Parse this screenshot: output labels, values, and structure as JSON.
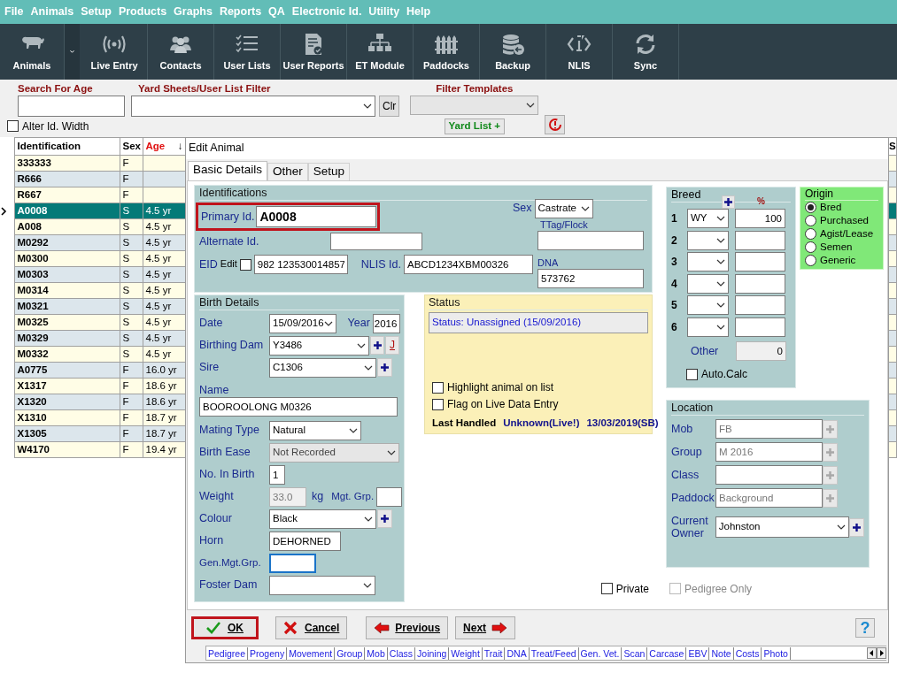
{
  "menu": [
    "File",
    "Animals",
    "Setup",
    "Products",
    "Graphs",
    "Reports",
    "QA",
    "Electronic Id.",
    "Utility",
    "Help"
  ],
  "toolbar": [
    {
      "label": "Animals",
      "dropdown": true
    },
    {
      "label": "Live Entry",
      "dropdown": false
    },
    {
      "label": "Contacts",
      "dropdown": false
    },
    {
      "label": "User Lists",
      "dropdown": false
    },
    {
      "label": "User Reports",
      "dropdown": false
    },
    {
      "label": "ET Module",
      "dropdown": false
    },
    {
      "label": "Paddocks",
      "dropdown": false
    },
    {
      "label": "Backup",
      "dropdown": false
    },
    {
      "label": "NLIS",
      "dropdown": false
    },
    {
      "label": "Sync",
      "dropdown": false
    }
  ],
  "filters": {
    "search": {
      "label": "Search For Age"
    },
    "user_list": {
      "label": "Yard Sheets/User List Filter"
    },
    "clear_button": "Clr",
    "templates": {
      "label": "Filter Templates",
      "disabled": true
    },
    "yard_list_button": "Yard List +",
    "alter_id_width": {
      "label": "Alter Id. Width",
      "checked": false
    }
  },
  "animal_list": {
    "columns": [
      "Identification",
      "Sex",
      "Age"
    ],
    "sort_indicator": "↓",
    "edge_column": "S",
    "rows": [
      {
        "id": "333333",
        "sex": "F",
        "selected": false
      },
      {
        "id": "R666",
        "sex": "F",
        "selected": false
      },
      {
        "id": "R667",
        "sex": "F",
        "selected": false
      },
      {
        "id": "A0008",
        "sex": "S",
        "age": "4.5 yr",
        "selected": true
      },
      {
        "id": "A008",
        "sex": "S",
        "age": "4.5 yr",
        "selected": false
      },
      {
        "id": "M0292",
        "sex": "S",
        "age": "4.5 yr",
        "selected": false
      },
      {
        "id": "M0300",
        "sex": "S",
        "age": "4.5 yr",
        "selected": false
      },
      {
        "id": "M0303",
        "sex": "S",
        "age": "4.5 yr",
        "selected": false
      },
      {
        "id": "M0314",
        "sex": "S",
        "age": "4.5 yr",
        "selected": false
      },
      {
        "id": "M0321",
        "sex": "S",
        "age": "4.5 yr",
        "selected": false
      },
      {
        "id": "M0325",
        "sex": "S",
        "age": "4.5 yr",
        "selected": false
      },
      {
        "id": "M0329",
        "sex": "S",
        "age": "4.5 yr",
        "selected": false
      },
      {
        "id": "M0332",
        "sex": "S",
        "age": "4.5 yr",
        "selected": false
      },
      {
        "id": "A0775",
        "sex": "F",
        "age": "16.0 yr",
        "selected": false
      },
      {
        "id": "X1317",
        "sex": "F",
        "age": "18.6 yr",
        "selected": false
      },
      {
        "id": "X1320",
        "sex": "F",
        "age": "18.6 yr",
        "selected": false
      },
      {
        "id": "X1310",
        "sex": "F",
        "age": "18.7 yr",
        "selected": false
      },
      {
        "id": "X1305",
        "sex": "F",
        "age": "18.7 yr",
        "selected": false
      },
      {
        "id": "W4170",
        "sex": "F",
        "age": "19.4 yr",
        "selected": false
      }
    ]
  },
  "dialog": {
    "title": "Edit Animal",
    "tabs": [
      {
        "label": "Basic Details",
        "selected": true
      },
      {
        "label": "Other",
        "selected": false
      },
      {
        "label": "Setup",
        "selected": false
      }
    ],
    "identifications": {
      "title": "Identifications",
      "primary_id": {
        "label": "Primary Id.",
        "value": "A0008",
        "highlighted": true
      },
      "alternate_id": {
        "label": "Alternate Id."
      },
      "eid": {
        "label": "EID",
        "edit_label": "Edit",
        "edit_checked": false,
        "value": "982 123530014857"
      },
      "nlis_id": {
        "label": "NLIS Id.",
        "value": "ABCD1234XBM00326"
      },
      "sex": {
        "label": "Sex",
        "value": "Castrate"
      },
      "ttag": {
        "label": "TTag/Flock"
      },
      "dna": {
        "label": "DNA",
        "value": "573762"
      }
    },
    "birth_details": {
      "title": "Birth Details",
      "date": {
        "label": "Date",
        "value": "15/09/2016"
      },
      "year": {
        "label": "Year",
        "value": "2016"
      },
      "birthing_dam": {
        "label": "Birthing Dam",
        "value": "Y3486",
        "link_button": "J"
      },
      "sire": {
        "label": "Sire",
        "value": "C1306"
      },
      "name": {
        "label": "Name",
        "value": "BOOROOLONG M0326"
      },
      "mating_type": {
        "label": "Mating Type",
        "value": "Natural"
      },
      "birth_ease": {
        "label": "Birth Ease",
        "value": "Not Recorded",
        "disabled": true
      },
      "no_in_birth": {
        "label": "No. In Birth",
        "value": "1"
      },
      "weight": {
        "label": "Weight",
        "value": "33.0",
        "unit": "kg"
      },
      "mgt_grp": {
        "label": "Mgt. Grp."
      },
      "colour": {
        "label": "Colour",
        "value": "Black"
      },
      "horn": {
        "label": "Horn",
        "value": "DEHORNED"
      },
      "gen_mgt_grp": {
        "label": "Gen.Mgt.Grp.",
        "focused": true
      },
      "foster_dam": {
        "label": "Foster Dam"
      }
    },
    "status": {
      "title": "Status",
      "text": "Status: Unassigned (15/09/2016)",
      "highlight": {
        "label": "Highlight animal on list",
        "checked": false
      },
      "flag_live": {
        "label": "Flag on Live Data Entry",
        "checked": false
      },
      "last_handled": {
        "label": "Last Handled",
        "who": "Unknown(Live!)",
        "date": "13/03/2019(SB)"
      }
    },
    "breed": {
      "title": "Breed",
      "percent_header": "%",
      "rows": [
        {
          "number": "1",
          "breed": "WY",
          "percent": "100"
        },
        {
          "number": "2"
        },
        {
          "number": "3"
        },
        {
          "number": "4"
        },
        {
          "number": "5"
        },
        {
          "number": "6"
        }
      ],
      "other": {
        "label": "Other",
        "value": "0"
      },
      "auto_calc": {
        "label": "Auto.Calc",
        "checked": false
      }
    },
    "origin": {
      "title": "Origin",
      "options": [
        {
          "label": "Bred",
          "selected": true
        },
        {
          "label": "Purchased",
          "selected": false
        },
        {
          "label": "Agist/Lease",
          "selected": false
        },
        {
          "label": "Semen",
          "selected": false
        },
        {
          "label": "Generic",
          "selected": false
        }
      ]
    },
    "location": {
      "title": "Location",
      "fields": [
        {
          "label": "Mob",
          "value": "FB",
          "kind": "locked"
        },
        {
          "label": "Group",
          "value": "M 2016",
          "kind": "locked"
        },
        {
          "label": "Class",
          "kind": "locked"
        },
        {
          "label": "Paddock",
          "value": "Background",
          "kind": "locked"
        },
        {
          "label": "Current Owner",
          "value": "Johnston",
          "kind": "dropdown"
        }
      ]
    },
    "private": {
      "label": "Private",
      "checked": false
    },
    "pedigree_only": {
      "label": "Pedigree Only",
      "checked": false,
      "disabled": true
    },
    "buttons": [
      {
        "label": "OK",
        "highlighted": true
      },
      {
        "label": "Cancel",
        "highlighted": false
      },
      {
        "label": "Previous",
        "highlighted": false
      },
      {
        "label": "Next",
        "highlighted": false
      }
    ],
    "help_button": "?",
    "links": [
      "Pedigree",
      "Progeny",
      "Movement",
      "Group",
      "Mob",
      "Class",
      "Joining",
      "Weight",
      "Trait",
      "DNA",
      "Treat/Feed",
      "Gen. Vet.",
      "Scan",
      "Carcase",
      "EBV",
      "Note",
      "Costs",
      "Photo"
    ]
  }
}
